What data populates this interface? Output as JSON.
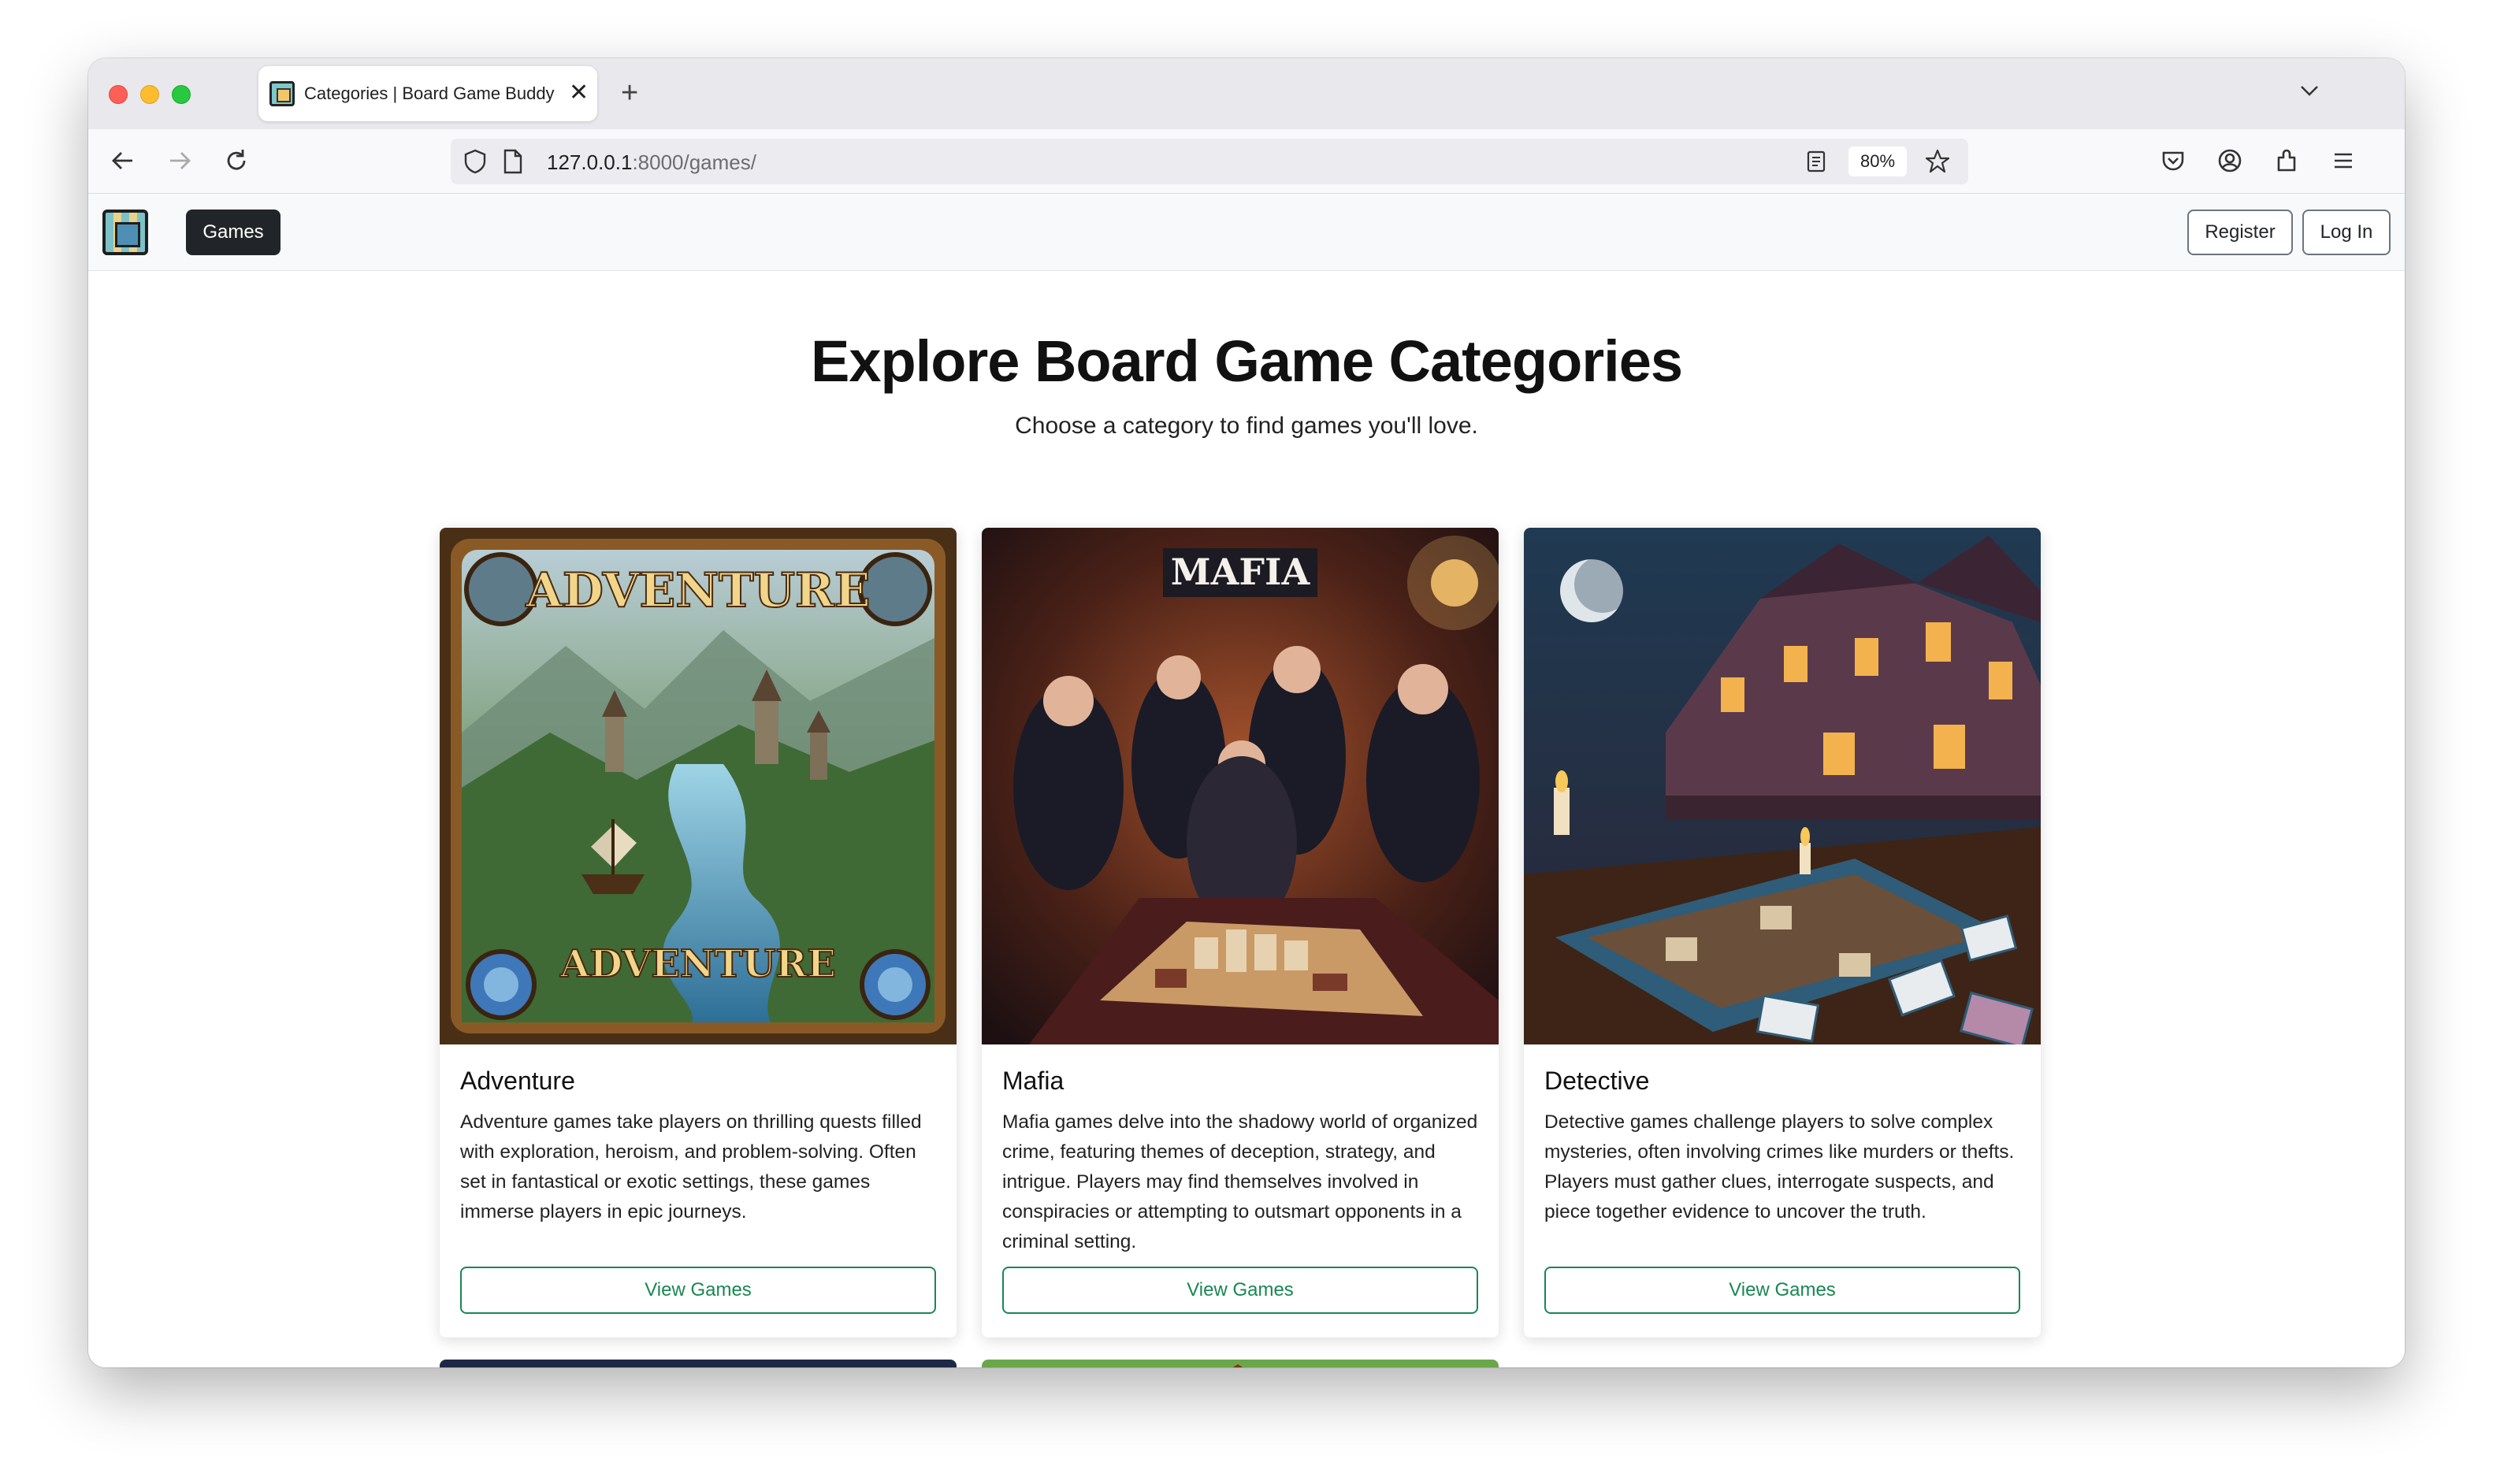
{
  "browser": {
    "tab_title": "Categories | Board Game Buddy",
    "tab_close": "✕",
    "new_tab": "+",
    "url_host": "127.0.0.1",
    "url_rest": ":8000/games/",
    "zoom": "80%"
  },
  "navbar": {
    "games_label": "Games",
    "register_label": "Register",
    "login_label": "Log In"
  },
  "page": {
    "title": "Explore Board Game Categories",
    "subtitle": "Choose a category to find games you'll love."
  },
  "categories": [
    {
      "name": "Adventure",
      "description": "Adventure games take players on thrilling quests filled with exploration, heroism, and problem-solving. Often set in fantastical or exotic settings, these games immerse players in epic journeys.",
      "button": "View Games",
      "art_text": "ADVENTURE",
      "art_text_bottom": "ADVENTURE"
    },
    {
      "name": "Mafia",
      "description": "Mafia games delve into the shadowy world of organized crime, featuring themes of deception, strategy, and intrigue. Players may find themselves involved in conspiracies or attempting to outsmart opponents in a criminal setting.",
      "button": "View Games",
      "art_text": "MAFIA"
    },
    {
      "name": "Detective",
      "description": "Detective games challenge players to solve complex mysteries, often involving crimes like murders or thefts. Players must gather clues, interrogate suspects, and piece together evidence to uncover the truth.",
      "button": "View Games"
    }
  ],
  "colors": {
    "success": "#198754",
    "dark": "#212529",
    "nav_bg": "#f8f9fa"
  }
}
